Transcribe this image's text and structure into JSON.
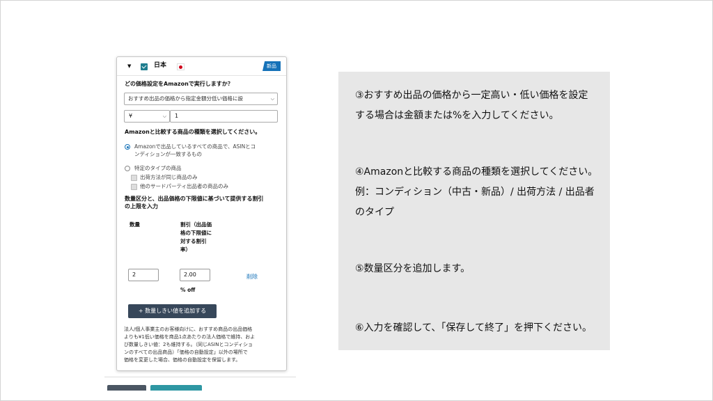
{
  "panel": {
    "country": "日本",
    "badge": "新品",
    "question": "どの価格設定をAmazonで実行しますか？",
    "price_rule_select": "おすすめ出品の価格から指定金額分低い価格に設",
    "currency_select": "¥",
    "amount_value": "1",
    "compare_heading": "Amazonと比較する商品の種類を選択してください。",
    "radio_all_line1": "Amazonで出品しているすべての商品で、ASINとコ",
    "radio_all_line2": "ンディションが一致するもの",
    "radio_specific": "特定のタイプの商品",
    "check_same_fulfillment": "出荷方法が同じ商品のみ",
    "check_third_party": "他のサードパーティ出品者の商品のみ",
    "tier_heading_line1": "数量区分と、出品価格の下限値に基づいて提供する割引",
    "tier_heading_line2": "の上限を入力",
    "col_quantity": "数量",
    "col_discount_lines": [
      "割引（出品価",
      "格の下限値に",
      "対する割引",
      "率）"
    ],
    "row_quantity": "2",
    "row_discount": "2.00",
    "percent_off": "% off",
    "delete_label": "削除",
    "add_tier_button": "+ 数量しきい値を追加する",
    "footnote_lines": [
      "法人/個人事業主のお客様向けに、おすすめ商品の出品価格",
      "よりも¥1低い価格を商品1点あたりの法人価格で維持、およ",
      "び数量しきい値：2も維持する。（同じASINとコンディショ",
      "ンのすべての出品商品）「価格の自動設定」以外の場所で",
      "価格を変更した場合、価格の自動設定を保留します。"
    ]
  },
  "info": {
    "line1": "③おすすめ出品の価格から一定高い・低い価格を設定",
    "line2": "する場合は金額または%を入力してください。",
    "line3": "④Amazonと比較する商品の種類を選択してください。",
    "line4": "例：コンディション（中古・新品）/ 出荷方法 / 出品者",
    "line5": "のタイプ",
    "line6": "⑤数量区分を追加します。",
    "line7": "⑥入力を確認して、「保存して終了」を押下ください。"
  },
  "colors": {
    "accent_teal": "#1f7e8f",
    "badge_blue": "#1672b8",
    "button_dark": "#37475a",
    "info_bg": "#e7e7e7"
  }
}
